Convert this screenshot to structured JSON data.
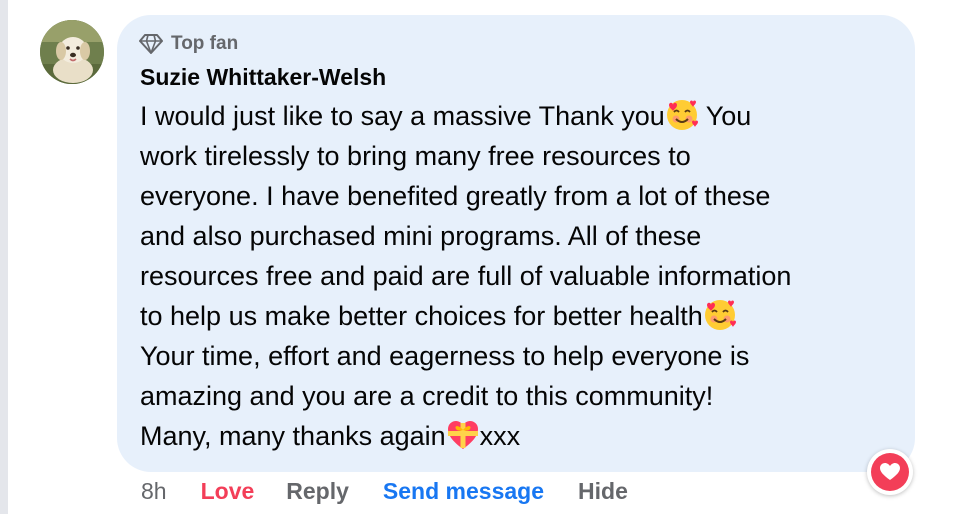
{
  "comment": {
    "badge": {
      "icon": "diamond-icon",
      "label": "Top fan"
    },
    "author": "Suzie Whittaker-Welsh",
    "lines": [
      {
        "before": "I would just like to say a massive Thank you",
        "emoji": "smiling-face-with-hearts",
        "after": " You"
      },
      {
        "before": "work tirelessly to bring many free resources to"
      },
      {
        "before": "everyone. I have benefited greatly from a lot of these"
      },
      {
        "before": "and also purchased mini programs. All of these"
      },
      {
        "before": "resources free and paid are full of valuable information"
      },
      {
        "before": "to help us make better choices for better health",
        "emoji": "smiling-face-with-hearts"
      },
      {
        "before": "Your time, effort and eagerness to help everyone is"
      },
      {
        "before": "amazing and you are a credit to this community!"
      },
      {
        "before": "Many, many thanks again",
        "emoji": "heart-with-ribbon",
        "after": "xxx"
      }
    ],
    "reaction": {
      "icon": "heart-icon",
      "color": "#f33e58"
    }
  },
  "actions": {
    "time": "8h",
    "love": "Love",
    "reply": "Reply",
    "send_message": "Send message",
    "hide": "Hide"
  },
  "colors": {
    "bubble": "#e7f0fb",
    "love": "#f33e58",
    "link": "#1877f2",
    "muted": "#65676b",
    "text": "#050505"
  }
}
